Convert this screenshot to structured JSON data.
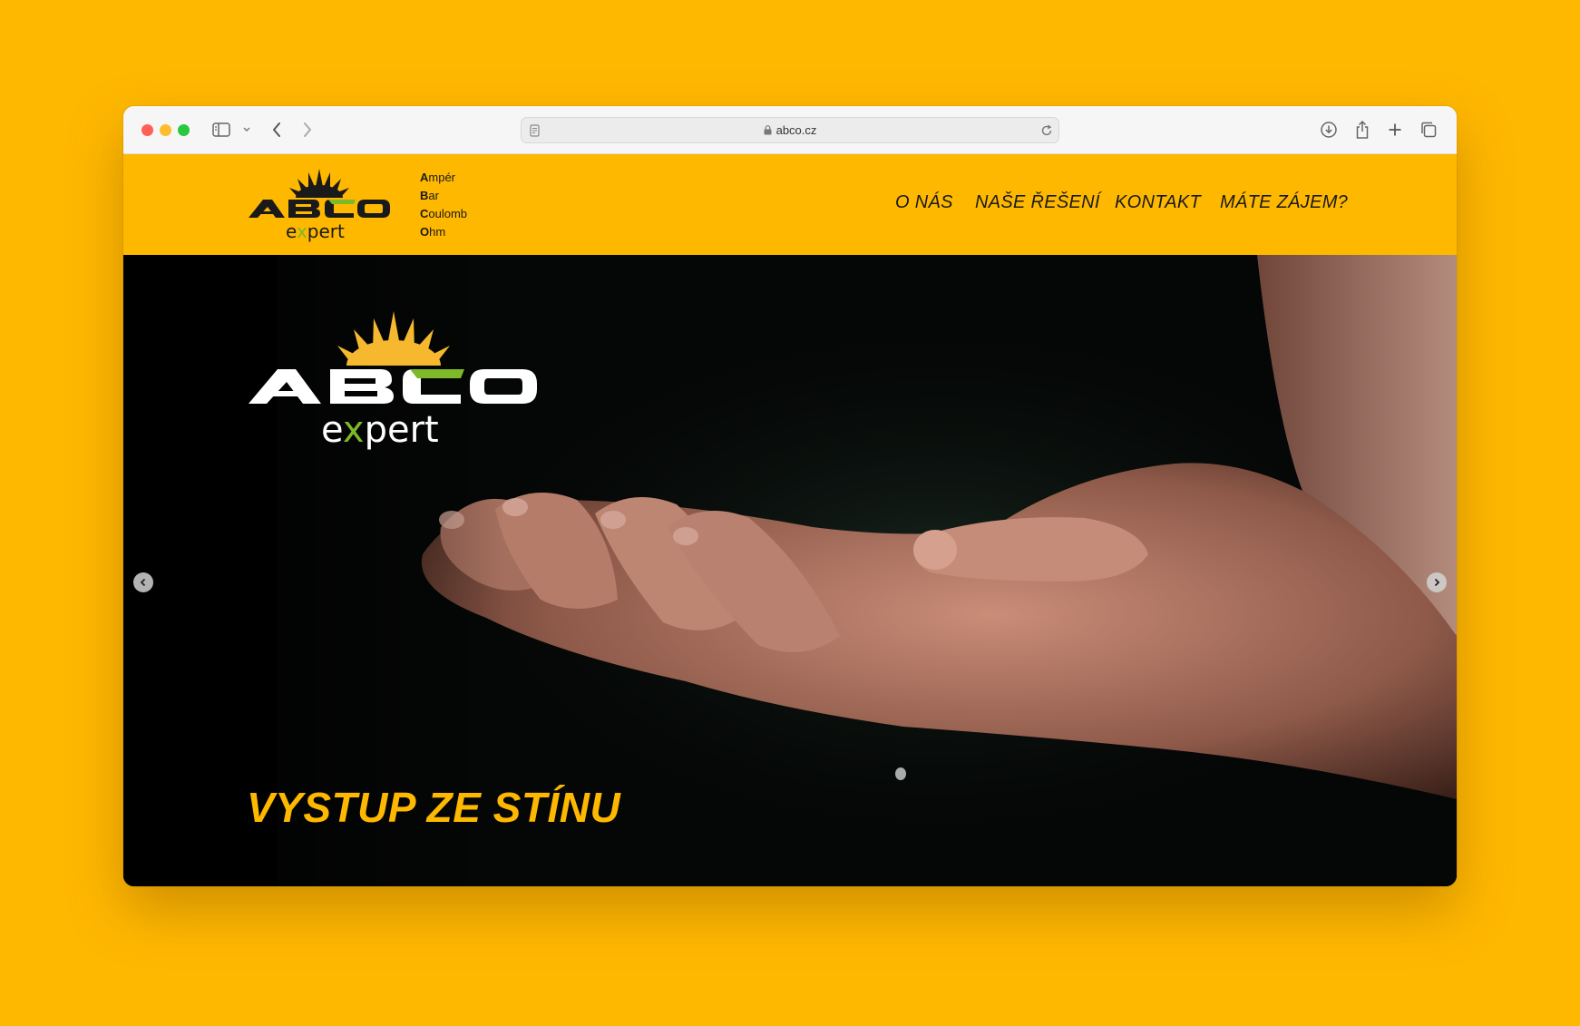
{
  "browser": {
    "url": "abco.cz"
  },
  "brand": {
    "logo_main": "ABCO",
    "logo_sub": "expert",
    "words": [
      {
        "initial": "A",
        "rest": "mpér"
      },
      {
        "initial": "B",
        "rest": "ar"
      },
      {
        "initial": "C",
        "rest": "oulomb"
      },
      {
        "initial": "O",
        "rest": "hm"
      }
    ]
  },
  "nav": {
    "items": [
      {
        "label": "O NÁS"
      },
      {
        "label": "NAŠE ŘEŠENÍ"
      },
      {
        "label": "KONTAKT"
      },
      {
        "label": "MÁTE ZÁJEM?"
      }
    ]
  },
  "hero": {
    "slogan": "VYSTUP ZE STÍNU"
  },
  "colors": {
    "brand_yellow": "#FFB800",
    "logo_green": "#7DB928",
    "hero_background": "#000000"
  }
}
